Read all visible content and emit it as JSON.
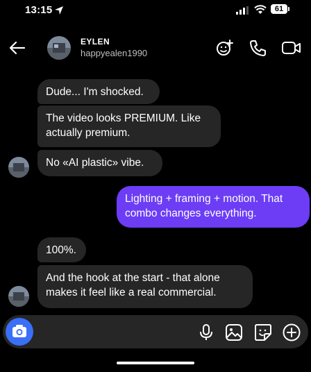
{
  "status_bar": {
    "time": "13:15",
    "battery": "61"
  },
  "header": {
    "name": "EYLEN",
    "username": "happyealen1990"
  },
  "messages": [
    {
      "text": "Dude... I'm shocked.",
      "direction": "incoming"
    },
    {
      "text": "The video looks PREMIUM. Like actually premium.",
      "direction": "incoming"
    },
    {
      "text": "No «AI plastic» vibe.",
      "direction": "incoming"
    },
    {
      "text": "Lighting + framing + motion. That combo changes everything.",
      "direction": "outgoing"
    },
    {
      "text": "100%.",
      "direction": "incoming"
    },
    {
      "text": "And the hook at the start - that alone makes it feel like a real commercial.",
      "direction": "incoming"
    }
  ],
  "composer": {
    "placeholder": ""
  },
  "colors": {
    "background": "#000000",
    "incoming_bubble": "#262626",
    "outgoing_bubble": "#6c3df5",
    "camera_button": "#3a6ff7"
  },
  "icons": {
    "back": "arrow-left-icon",
    "effects": "effects-face-icon",
    "call": "phone-icon",
    "video": "video-camera-icon",
    "camera": "camera-icon",
    "mic": "microphone-icon",
    "gallery": "image-icon",
    "sticker": "sticker-icon",
    "plus": "plus-circle-icon"
  }
}
